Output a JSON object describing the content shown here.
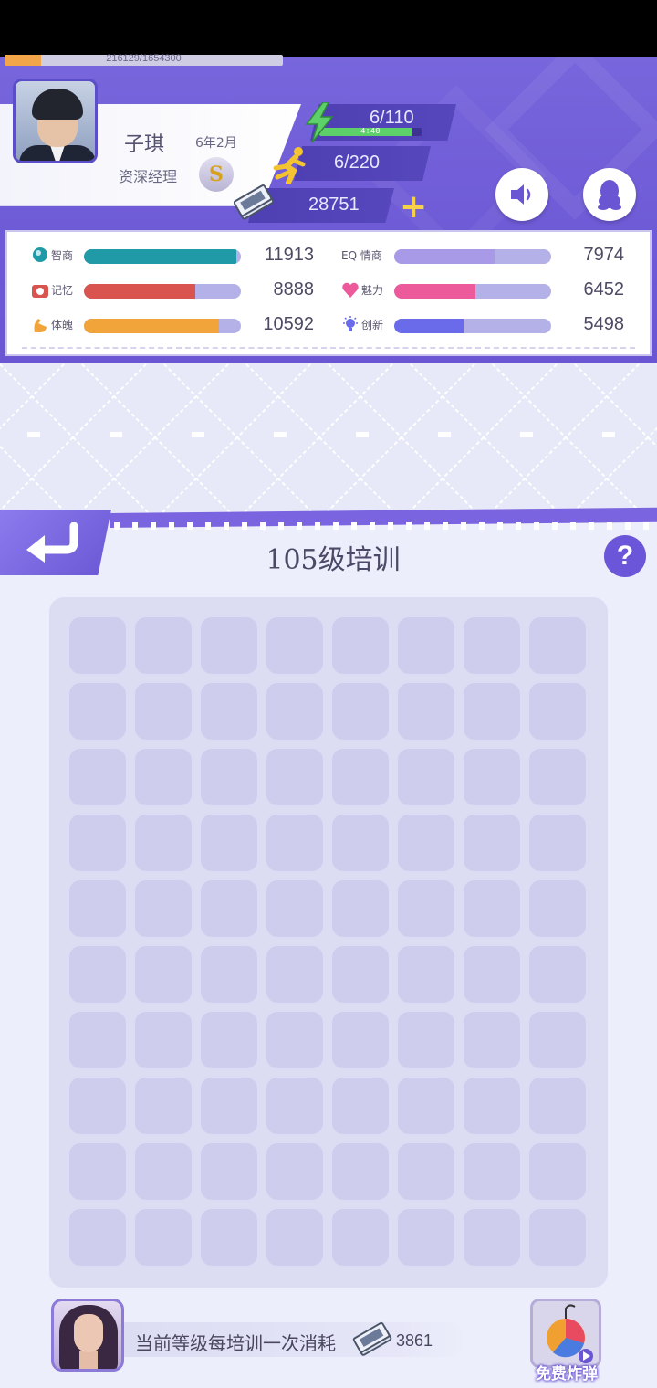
{
  "player": {
    "name": "子琪",
    "game_time": "6年2月",
    "title": "资深经理",
    "title_badge": "S",
    "xp_text": "216129/1654300",
    "xp_progress": 0.13
  },
  "resources": {
    "energy": "6/110",
    "energy_timer": "4:40",
    "energy_regen_progress": 0.9,
    "stamina": "6/220",
    "money": "28751"
  },
  "buttons": {
    "plus": "+",
    "help": "?"
  },
  "stats": [
    {
      "key": "iq",
      "label": "智商",
      "value": "11913",
      "fill": 0.97,
      "color": "#1f9aa6",
      "icon": "head-icon"
    },
    {
      "key": "eq",
      "label": "EQ 情商",
      "value": "7974",
      "fill": 0.64,
      "color": "#a99ae8",
      "icon": "eq-icon"
    },
    {
      "key": "memory",
      "label": "记忆",
      "value": "8888",
      "fill": 0.71,
      "color": "#d9534f",
      "icon": "memory-icon"
    },
    {
      "key": "charm",
      "label": "魅力",
      "value": "6452",
      "fill": 0.52,
      "color": "#ec5a9c",
      "icon": "heart-icon"
    },
    {
      "key": "physique",
      "label": "体魄",
      "value": "10592",
      "fill": 0.86,
      "color": "#f1a43a",
      "icon": "muscle-icon"
    },
    {
      "key": "innovation",
      "label": "创新",
      "value": "5498",
      "fill": 0.44,
      "color": "#6a6bea",
      "icon": "lightbulb-icon"
    }
  ],
  "training": {
    "title": "105级培训",
    "grid_rows": 10,
    "grid_cols": 8,
    "cost_text": "当前等级每培训一次消耗",
    "cost_value": "3861",
    "bomb_label": "免费炸弹"
  }
}
